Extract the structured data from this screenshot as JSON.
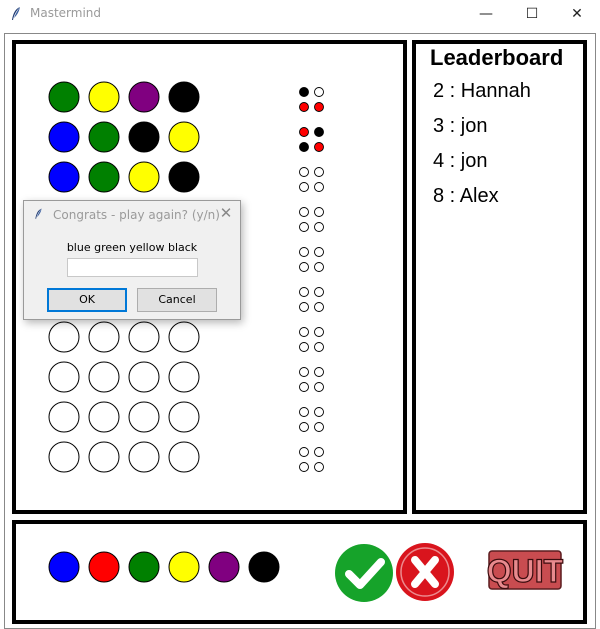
{
  "window": {
    "title": "Mastermind",
    "minimize_glyph": "—",
    "maximize_glyph": "☐",
    "close_glyph": "✕",
    "icon": "feather-icon"
  },
  "board": {
    "empty_color": "#ffffff",
    "guesses": [
      {
        "pegs": [
          "green",
          "yellow",
          "purple",
          "black"
        ],
        "feedback": [
          "black",
          "empty",
          "red",
          "red"
        ]
      },
      {
        "pegs": [
          "blue",
          "green",
          "black",
          "yellow"
        ],
        "feedback": [
          "red",
          "black",
          "black",
          "red"
        ]
      },
      {
        "pegs": [
          "blue",
          "green",
          "yellow",
          "black"
        ],
        "feedback": [
          "empty",
          "empty",
          "empty",
          "empty"
        ]
      },
      {
        "pegs": [
          "empty",
          "empty",
          "empty",
          "empty"
        ],
        "feedback": [
          "empty",
          "empty",
          "empty",
          "empty"
        ]
      },
      {
        "pegs": [
          "empty",
          "empty",
          "empty",
          "empty"
        ],
        "feedback": [
          "empty",
          "empty",
          "empty",
          "empty"
        ]
      },
      {
        "pegs": [
          "empty",
          "empty",
          "empty",
          "empty"
        ],
        "feedback": [
          "empty",
          "empty",
          "empty",
          "empty"
        ]
      },
      {
        "pegs": [
          "empty",
          "empty",
          "empty",
          "empty"
        ],
        "feedback": [
          "empty",
          "empty",
          "empty",
          "empty"
        ]
      },
      {
        "pegs": [
          "empty",
          "empty",
          "empty",
          "empty"
        ],
        "feedback": [
          "empty",
          "empty",
          "empty",
          "empty"
        ]
      },
      {
        "pegs": [
          "empty",
          "empty",
          "empty",
          "empty"
        ],
        "feedback": [
          "empty",
          "empty",
          "empty",
          "empty"
        ]
      },
      {
        "pegs": [
          "empty",
          "empty",
          "empty",
          "empty"
        ],
        "feedback": [
          "empty",
          "empty",
          "empty",
          "empty"
        ]
      }
    ]
  },
  "colors": {
    "green": "#008000",
    "yellow": "#ffff00",
    "purple": "#800080",
    "black": "#000000",
    "blue": "#0000ff",
    "red": "#ff0000",
    "empty": "#ffffff"
  },
  "leaderboard": {
    "title": "Leaderboard",
    "entries": [
      "2 : Hannah",
      "3 : jon",
      "4 : jon",
      "8 : Alex"
    ]
  },
  "palette": {
    "colors": [
      "blue",
      "red",
      "green",
      "yellow",
      "purple",
      "black"
    ]
  },
  "controls": {
    "check_icon": "check-icon",
    "check_color": "#16a32a",
    "clear_icon": "x-icon",
    "clear_color": "#d9141d",
    "quit_label": "QUIT",
    "quit_color": "#c94c50"
  },
  "dialog": {
    "title": "Congrats - play again? (y/n)",
    "message": "blue green yellow black",
    "input_value": "",
    "ok_label": "OK",
    "cancel_label": "Cancel",
    "close_glyph": "✕"
  }
}
